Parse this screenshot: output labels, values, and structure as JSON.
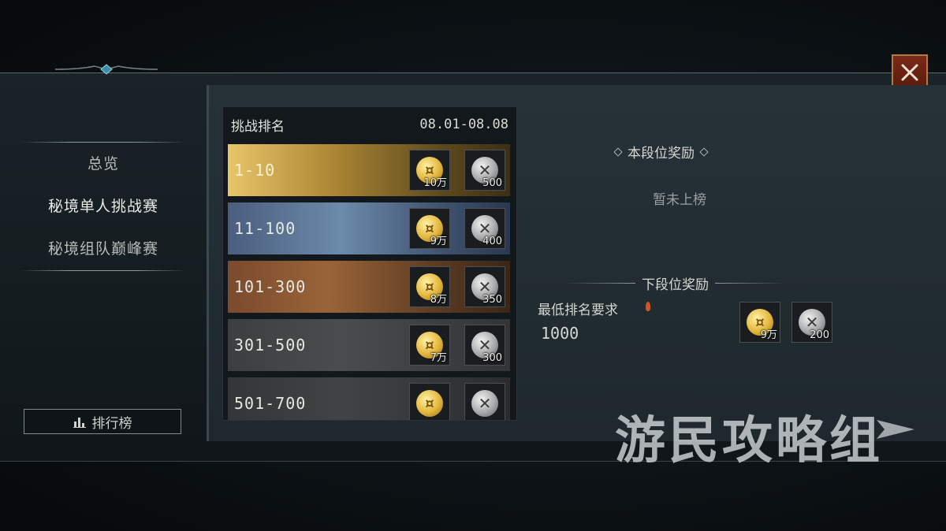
{
  "sidebar": {
    "items": [
      {
        "label": "总览"
      },
      {
        "label": "秘境单人挑战赛"
      },
      {
        "label": "秘境组队巅峰赛"
      }
    ],
    "ranking_button": "排行榜"
  },
  "ranking_list": {
    "title": "挑战排名",
    "date_range": "08.01-08.08",
    "rows": [
      {
        "range": "1-10",
        "rewards": [
          {
            "icon": "gold-coin-icon",
            "qty": "10万"
          },
          {
            "icon": "silver-medal-icon",
            "qty": "500"
          }
        ]
      },
      {
        "range": "11-100",
        "rewards": [
          {
            "icon": "gold-coin-icon",
            "qty": "9万"
          },
          {
            "icon": "silver-medal-icon",
            "qty": "400"
          }
        ]
      },
      {
        "range": "101-300",
        "rewards": [
          {
            "icon": "gold-coin-icon",
            "qty": "8万"
          },
          {
            "icon": "silver-medal-icon",
            "qty": "350"
          }
        ]
      },
      {
        "range": "301-500",
        "rewards": [
          {
            "icon": "gold-coin-icon",
            "qty": "7万"
          },
          {
            "icon": "silver-medal-icon",
            "qty": "300"
          }
        ]
      },
      {
        "range": "501-700",
        "rewards": [
          {
            "icon": "gold-coin-icon",
            "qty": ""
          },
          {
            "icon": "silver-medal-icon",
            "qty": ""
          }
        ]
      }
    ]
  },
  "current_reward": {
    "title": "本段位奖励",
    "empty_text": "暂未上榜"
  },
  "next_reward": {
    "title": "下段位奖励",
    "min_rank_label": "最低排名要求",
    "min_rank_value": "1000",
    "rewards": [
      {
        "icon": "gold-coin-icon",
        "qty": "9万"
      },
      {
        "icon": "silver-medal-icon",
        "qty": "200"
      }
    ]
  },
  "watermark": "游民攻略组",
  "colors": {
    "close_button": "#6a2212",
    "accent_gold": "#e3b63c"
  }
}
